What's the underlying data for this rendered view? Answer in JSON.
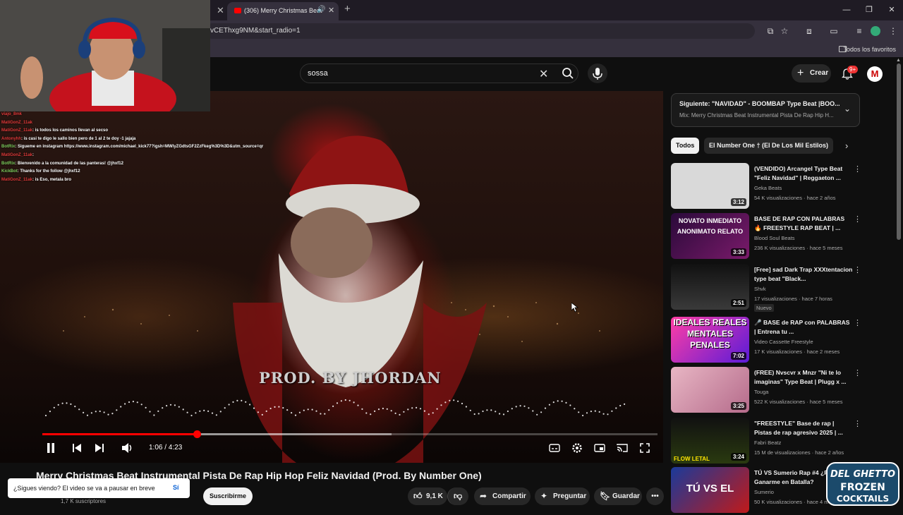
{
  "browser": {
    "active_tab_title": "(306) Merry Christmas Beat",
    "url_fragment": "vCEThxg9NM&start_radio=1",
    "bookmarks_label": "Todos los favoritos"
  },
  "header": {
    "search_value": "sossa",
    "create_label": "Crear",
    "notif_count": "9+",
    "avatar_letter": "M"
  },
  "player": {
    "watermark": "PROD. BY JHORDAN",
    "current_time": "1:06",
    "duration": "4:23",
    "time_display": "1:06 / 4:23",
    "progress_fraction": 0.251,
    "buffered_fraction": 0.568
  },
  "video": {
    "title": "Merry Christmas Beat Instrumental Pista De Rap Hip Hop Feliz Navidad (Prod. By Number One)",
    "subscribers": "1,7 K suscriptores",
    "subscribe_label": "Suscribirme",
    "likes": "9,1 K",
    "share_label": "Compartir",
    "ask_label": "Preguntar",
    "save_label": "Guardar"
  },
  "toast": {
    "text": "¿Sigues viendo? El video se va a pausar en breve",
    "confirm_label": "Sí"
  },
  "up_next": {
    "title": "Siguiente: \"NAVIDAD\" - BOOMBAP Type Beat |BOO...",
    "subtitle": "Mix: Merry Christmas Beat Instrumental Pista De Rap Hip H..."
  },
  "chips": [
    "Todos",
    "El Number One † (El De Los Mil Estilos)"
  ],
  "recommendations": [
    {
      "title": "(VENDIDO) Arcangel Type Beat \"Feliz Navidad\" | Reggaeton ...",
      "channel": "Geka Beats",
      "meta": "54 K visualizaciones · hace 2 años",
      "duration": "3:12",
      "thumb_text": ""
    },
    {
      "title": "BASE DE RAP CON PALABRAS 🔥 FREESTYLE RAP BEAT | ...",
      "channel": "Blood Soul Beats",
      "meta": "236 K visualizaciones · hace 5 meses",
      "duration": "3:33",
      "thumb_text": "NOVATO INMEDIATO ANONIMATO RELATO"
    },
    {
      "title": "[Free] sad Dark Trap XXXtentacion type beat \"Black...",
      "channel": "Shvk",
      "meta": "17 visualizaciones · hace 7 horas",
      "duration": "2:51",
      "badge": "Nuevo",
      "thumb_text": ""
    },
    {
      "title": "🎤 BASE de RAP con PALABRAS | Entrena tu ...",
      "channel": "Video Cassette Freestyle",
      "meta": "17 K visualizaciones · hace 2 meses",
      "duration": "7:02",
      "thumb_text": "IDEALES REALES MENTALES PENALES"
    },
    {
      "title": "(FREE) Nvscvr x Mnzr \"Ni te lo imaginas\" Type Beat | Plugg x ...",
      "channel": "Touga",
      "meta": "522 K visualizaciones · hace 5 meses",
      "duration": "3:25",
      "thumb_text": ""
    },
    {
      "title": "\"FREESTYLE\" Base de rap | Pistas de rap agresivo 2025 | ...",
      "channel": "Fabri Beatz",
      "meta": "15 M de visualizaciones · hace 2 años",
      "duration": "3:24",
      "thumb_text": "FLOW LETAL"
    },
    {
      "title": "TÚ VS Sumerio Rap #4 ¿Podrás Ganarme en Batalla?",
      "channel": "Sumerio",
      "meta": "50 K visualizaciones · hace 4 m",
      "duration": "",
      "thumb_text": "TÚ VS EL"
    }
  ],
  "chat": [
    {
      "user": "viajo_8mk",
      "msg": ""
    },
    {
      "user": "MatiGonZ_11ak",
      "msg": ""
    },
    {
      "user": "MatiGonZ_11ak",
      "msg": ": is todos los caminos llevan al secso"
    },
    {
      "user": "Antonyhh",
      "msg": ": is casi te digo le sallo bien pero de 1 al 2 te doy -1 jajaja"
    },
    {
      "user": "BotRix",
      "msg": ": Sigueme en instagram https://www.instagram.com/michael_kick77?igsh=MWlyZGdtsGF2ZzFkeg%3D%3D&utm_source=qr",
      "bot": true
    },
    {
      "user": "MatiGonZ_11ak",
      "msg": ":"
    },
    {
      "user": "BotRix",
      "msg": ": Bienvenido a la comunidad de las panteras! @jhxf12",
      "bot": true
    },
    {
      "user": "KickBot",
      "msg": ": Thanks for the follow @jhxf12",
      "bot": true
    },
    {
      "user": "MatiGonZ_11ak",
      "msg": ": is Eso, metala bro"
    }
  ],
  "overlay_logo": {
    "line1": "DEL GHETTO",
    "line2": "FROZEN",
    "line3": "COCKTAILS"
  },
  "colors": {
    "accent": "#ff0000",
    "bg": "#0f0f0f",
    "chip_bg": "#272727"
  }
}
